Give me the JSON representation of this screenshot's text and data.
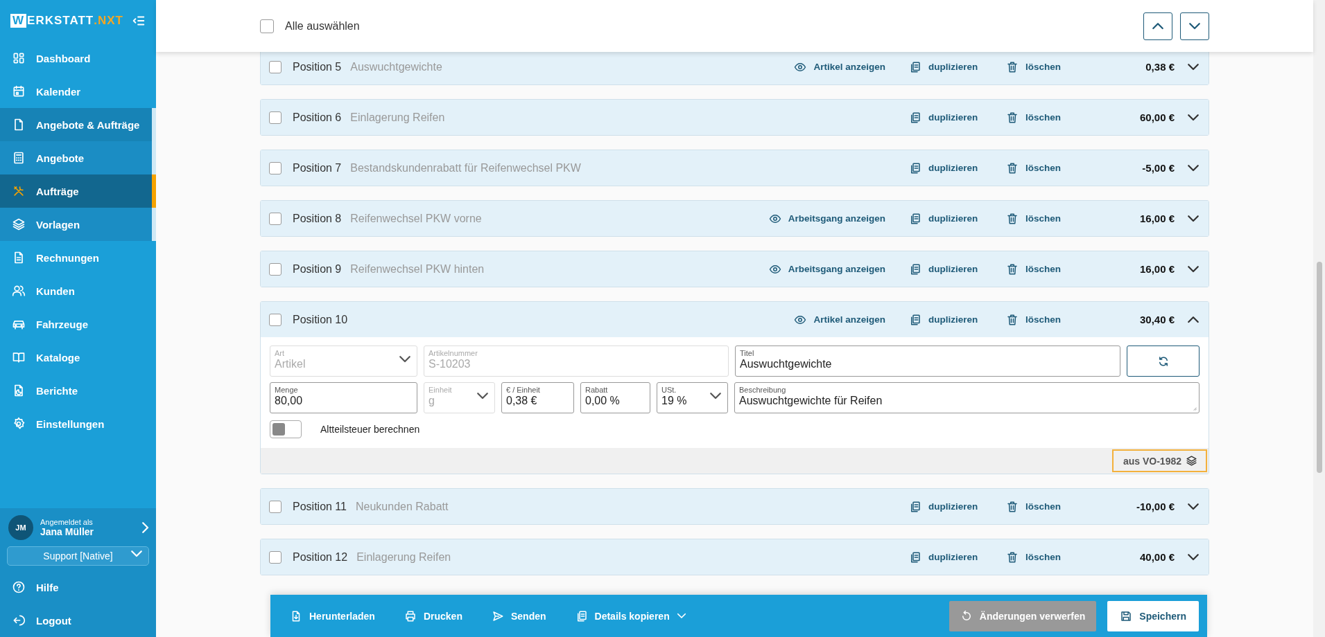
{
  "sidebar": {
    "logo": {
      "boxed": "W",
      "main": "ERKSTATT",
      "accent": ".NXT"
    },
    "items": [
      {
        "label": "Dashboard",
        "selected": false
      },
      {
        "label": "Kalender",
        "selected": false
      },
      {
        "label": "Angebote & Aufträge",
        "selected": false,
        "expanded": true,
        "children": [
          {
            "label": "Angebote",
            "selected": false
          },
          {
            "label": "Aufträge",
            "selected": true
          },
          {
            "label": "Vorlagen",
            "selected": false
          }
        ]
      },
      {
        "label": "Rechnungen",
        "selected": false
      },
      {
        "label": "Kunden",
        "selected": false
      },
      {
        "label": "Fahrzeuge",
        "selected": false
      },
      {
        "label": "Kataloge",
        "selected": false
      },
      {
        "label": "Berichte",
        "selected": false
      },
      {
        "label": "Einstellungen",
        "selected": false
      }
    ],
    "user": {
      "initials": "JM",
      "caption": "Angemeldet als",
      "name": "Jana Müller"
    },
    "role": "Support [Native]",
    "footer": [
      {
        "label": "Hilfe"
      },
      {
        "label": "Logout"
      }
    ]
  },
  "header": {
    "select_all": {
      "label": "Alle auswählen",
      "checked": false
    }
  },
  "positions": [
    {
      "label": "Position 5",
      "title": "Auswuchtgewichte",
      "view_link": "Artikel anzeigen",
      "duplicate": "duplizieren",
      "delete": "löschen",
      "total": "0,38 €",
      "checked": false,
      "expanded": false
    },
    {
      "label": "Position 6",
      "title": "Einlagerung Reifen",
      "duplicate": "duplizieren",
      "delete": "löschen",
      "total": "60,00 €",
      "checked": false,
      "expanded": false
    },
    {
      "label": "Position 7",
      "title": "Bestandskundenrabatt für Reifenwechsel PKW",
      "duplicate": "duplizieren",
      "delete": "löschen",
      "total": "-5,00 €",
      "checked": false,
      "expanded": false
    },
    {
      "label": "Position 8",
      "title": "Reifenwechsel PKW vorne",
      "view_link": "Arbeitsgang anzeigen",
      "duplicate": "duplizieren",
      "delete": "löschen",
      "total": "16,00 €",
      "checked": false,
      "expanded": false
    },
    {
      "label": "Position 9",
      "title": "Reifenwechsel PKW hinten",
      "view_link": "Arbeitsgang anzeigen",
      "duplicate": "duplizieren",
      "delete": "löschen",
      "total": "16,00 €",
      "checked": false,
      "expanded": false
    },
    {
      "label": "Position 10",
      "view_link": "Artikel anzeigen",
      "duplicate": "duplizieren",
      "delete": "löschen",
      "total": "30,40 €",
      "checked": false,
      "expanded": true,
      "details": {
        "fields": [
          {
            "kind": "select",
            "label": "Art",
            "value": "Artikel",
            "disabled": true
          },
          {
            "kind": "text",
            "label": "Artikelnummer",
            "value": "S-10203",
            "disabled": true
          },
          {
            "kind": "text",
            "label": "Titel",
            "value": "Auswuchtgewichte",
            "disabled": false
          },
          {
            "kind": "text",
            "label": "Menge",
            "value": "80,00",
            "disabled": false
          },
          {
            "kind": "select",
            "label": "Einheit",
            "value": "g",
            "disabled": true
          },
          {
            "kind": "text",
            "label": "€ / Einheit",
            "value": "0,38 €",
            "disabled": false
          },
          {
            "kind": "text",
            "label": "Rabatt",
            "value": "0,00 %",
            "disabled": false
          },
          {
            "kind": "select",
            "label": "USt.",
            "value": "19 %",
            "disabled": false
          },
          {
            "kind": "textarea",
            "label": "Beschreibung",
            "value": "Auswuchtgewichte für Reifen",
            "disabled": false
          }
        ],
        "toggle": {
          "label": "Altteilsteuer berechnen",
          "on": false
        },
        "source": {
          "text": "aus VO-1982",
          "highlighted": true
        }
      }
    },
    {
      "label": "Position 11",
      "title": "Neukunden Rabatt",
      "duplicate": "duplizieren",
      "delete": "löschen",
      "total": "-10,00 €",
      "checked": false,
      "expanded": false
    },
    {
      "label": "Position 12",
      "title": "Einlagerung Reifen",
      "duplicate": "duplizieren",
      "delete": "löschen",
      "total": "40,00 €",
      "checked": false,
      "expanded": false
    }
  ],
  "action_bar": {
    "actions": [
      {
        "label": "Herunterladen",
        "has_menu": false
      },
      {
        "label": "Drucken",
        "has_menu": false
      },
      {
        "label": "Senden",
        "has_menu": false
      },
      {
        "label": "Details kopieren",
        "has_menu": true
      }
    ],
    "discard": {
      "label": "Änderungen verwerfen",
      "disabled": true
    },
    "save": {
      "label": "Speichern"
    }
  }
}
